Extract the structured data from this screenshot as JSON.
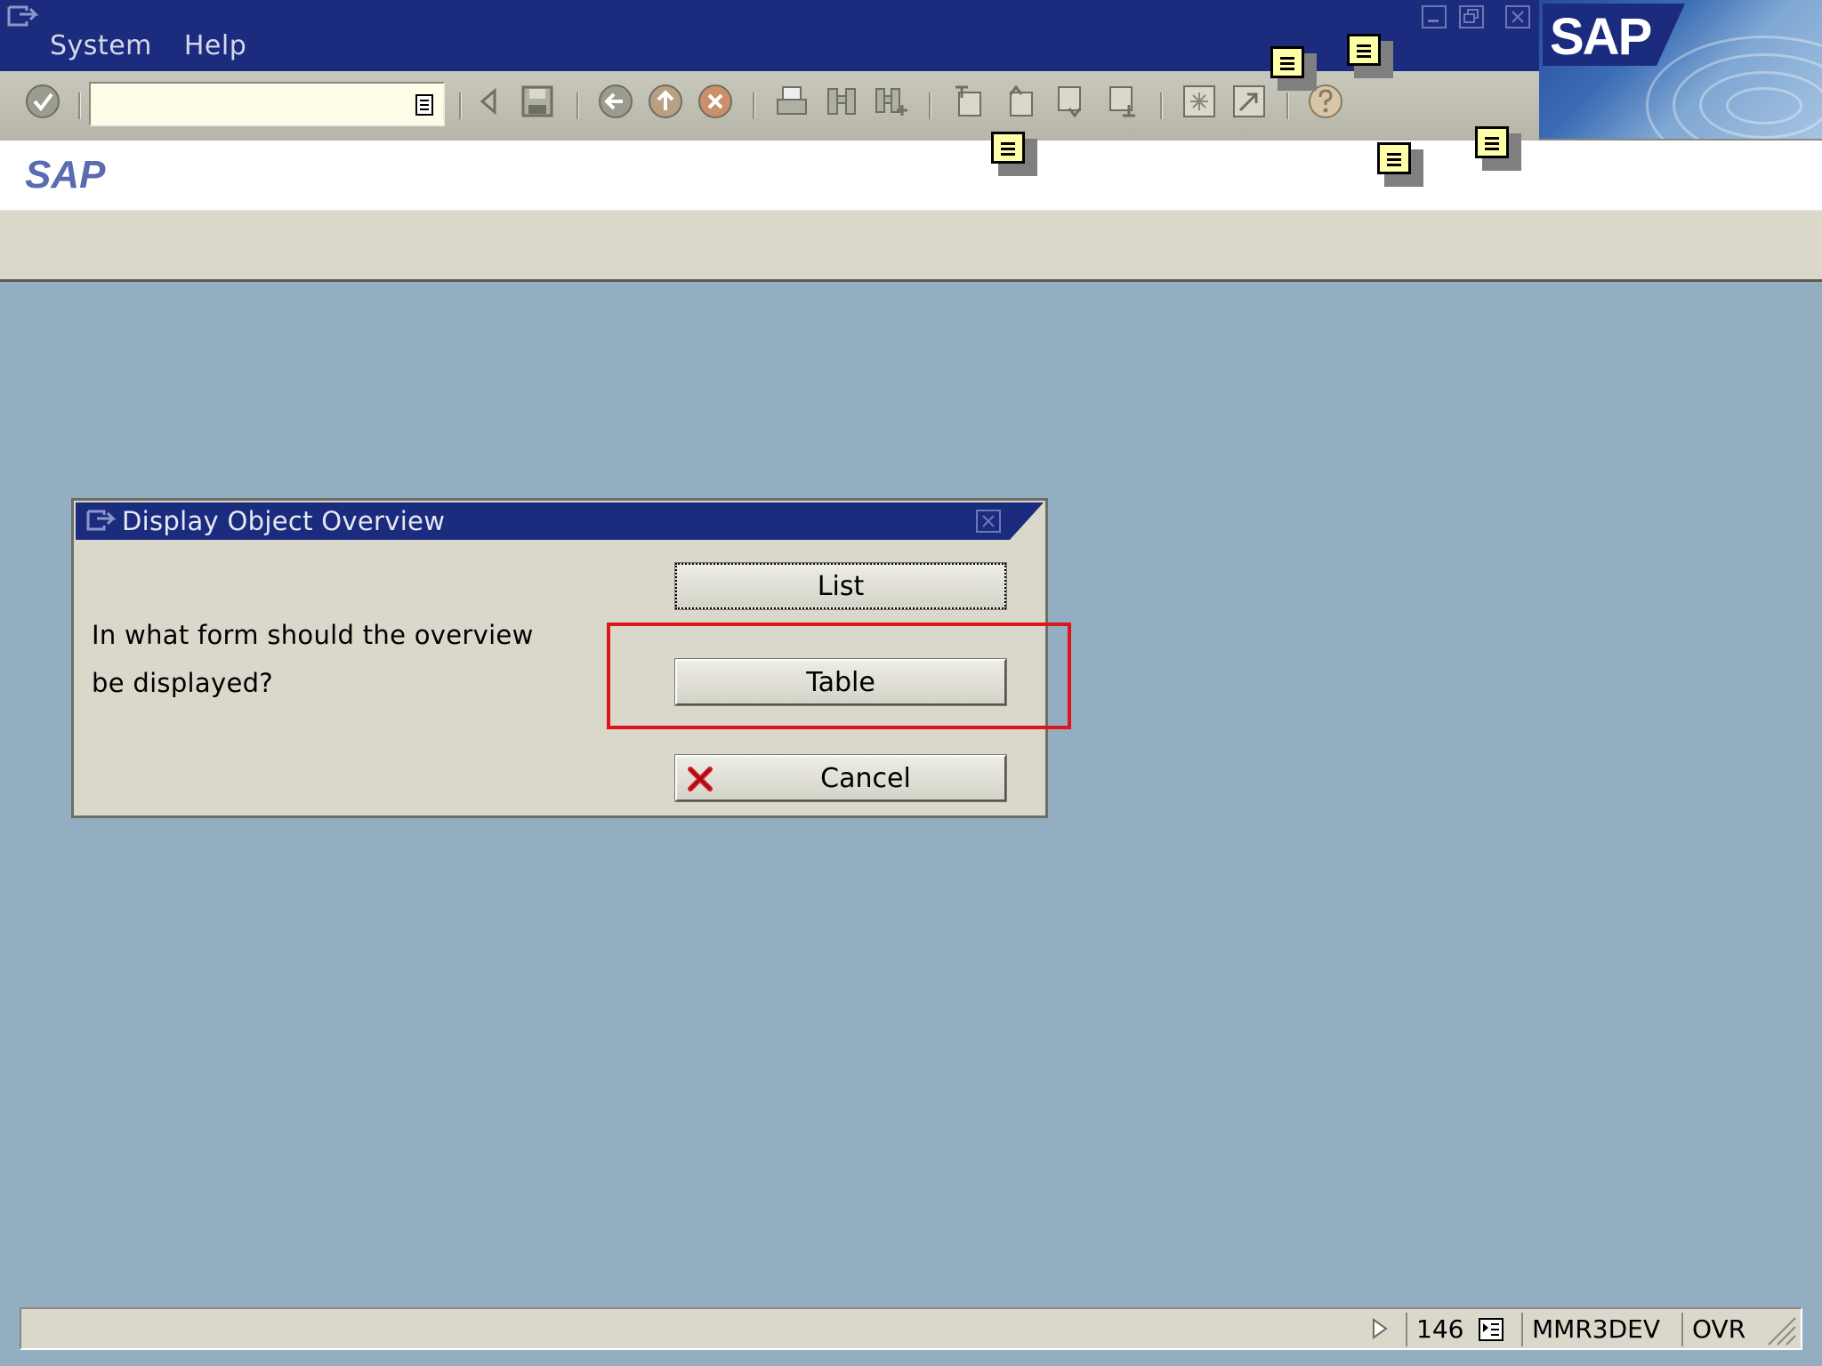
{
  "menubar": {
    "items": [
      "System",
      "Help"
    ]
  },
  "command_field": {
    "value": "",
    "placeholder": ""
  },
  "toolbar": {
    "icons": [
      "enter-icon",
      "back-arrow-icon",
      "save-icon",
      "back-icon",
      "exit-icon",
      "cancel-icon",
      "print-icon",
      "find-icon",
      "find-next-icon",
      "first-page-icon",
      "previous-page-icon",
      "next-page-icon",
      "last-page-icon",
      "create-session-icon",
      "shortcut-icon",
      "help-icon"
    ]
  },
  "page": {
    "title": "SAP"
  },
  "dialog": {
    "title": "Display Object Overview",
    "question_line1": "In what form should the overview",
    "question_line2": "be displayed?",
    "buttons": {
      "list": "List",
      "table": "Table",
      "cancel": "Cancel"
    }
  },
  "statusbar": {
    "session": "146",
    "system": "MMR3DEV",
    "mode": "OVR"
  },
  "colors": {
    "title_bar": "#1b2c7e",
    "toolbar": "#c9c8bc",
    "background": "#93adc1",
    "highlight": "#e0141b",
    "note": "#ffffa8"
  }
}
